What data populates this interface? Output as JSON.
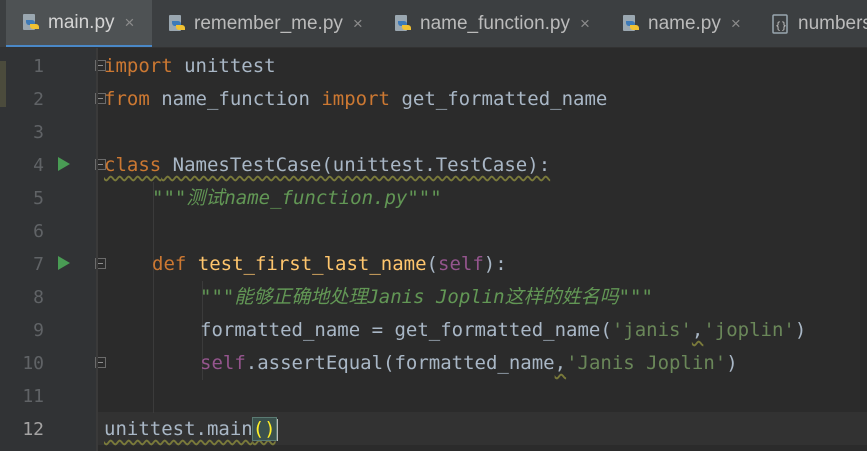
{
  "tabs": [
    {
      "label": "main.py",
      "active": true,
      "icon": "python-file-icon"
    },
    {
      "label": "remember_me.py",
      "active": false,
      "icon": "python-file-icon"
    },
    {
      "label": "name_function.py",
      "active": false,
      "icon": "python-file-icon"
    },
    {
      "label": "name.py",
      "active": false,
      "icon": "python-file-icon"
    },
    {
      "label": "numbers",
      "active": false,
      "icon": "json-file-icon"
    }
  ],
  "close_glyph": "×",
  "line_numbers": [
    "1",
    "2",
    "3",
    "4",
    "5",
    "6",
    "7",
    "8",
    "9",
    "10",
    "11",
    "12"
  ],
  "current_line": "12",
  "code": {
    "l1": {
      "kw": "import",
      "rest": " unittest"
    },
    "l2": {
      "kw1": "from",
      "mod": " name_function ",
      "kw2": "import",
      "rest": " get_formatted_name"
    },
    "l4": {
      "kw": "class",
      "name": " NamesTestCase(unittest.TestCase):"
    },
    "l5": {
      "doc": "\"\"\"测试name_function.py\"\"\""
    },
    "l7": {
      "kw": "def",
      "name": "test_first_last_name",
      "open": "(",
      "self": "self",
      "close": "):"
    },
    "l8": {
      "doc": "\"\"\"能够正确地处理Janis Joplin这样的姓名吗\"\"\""
    },
    "l9": {
      "pre": "formatted_name = get_formatted_name(",
      "s1": "'janis'",
      "comma": ",",
      "s2": "'joplin'",
      "post": ")"
    },
    "l10": {
      "self": "self",
      "pre": ".assertEqual(formatted_name",
      "comma": ",",
      "s1": "'Janis Joplin'",
      "post": ")"
    },
    "l12": {
      "pre": "unittest.main",
      "br": "()"
    }
  },
  "colors": {
    "keyword": "#cc7832",
    "function": "#ffc66d",
    "string": "#6a8759",
    "docstring": "#629755",
    "self": "#94558d",
    "text": "#a9b7c6",
    "run_icon": "#499c54",
    "active_tab_underline": "#4a88c7"
  }
}
